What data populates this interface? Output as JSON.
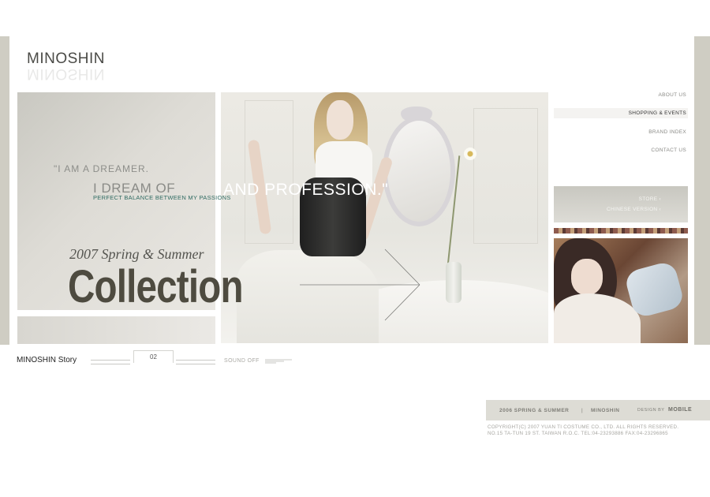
{
  "brand": {
    "logo": "MINOSHIN"
  },
  "hero": {
    "quote_line1": "\"I AM A DREAMER.",
    "quote_line2_gray": "I DREAM OF",
    "quote_line2_white": "AND PROFESSION.\"",
    "quote_line3": "PERFECT BALANCE  BETWEEN MY PASSIONS",
    "season": "2007 Spring & Summer",
    "collection": "Collection"
  },
  "nav": {
    "items": [
      {
        "label": "ABOUT US"
      },
      {
        "label": "SHOPPING & EVENTS"
      },
      {
        "label": "BRAND INDEX"
      },
      {
        "label": "CONTACT US"
      }
    ]
  },
  "store_panel": {
    "links": [
      {
        "label": "STORE  ‹"
      },
      {
        "label": "CHINESE VERSION  ‹"
      }
    ]
  },
  "controls": {
    "story_label": "MINOSHIN Story",
    "page_number": "02",
    "sound_label": "SOUND OFF"
  },
  "footer": {
    "season": "2006  SPRING & SUMMER",
    "separator": "|",
    "brand": "MINOSHIN",
    "design_by": "DESIGN BY",
    "designer": "MOBILE",
    "copyright": "COPYRIGHT(C) 2007  YUAN TI COSTUME CO., LTD.    ALL RIGHTS RESERVED.",
    "address": "NO.15 TA-TUN 19 ST. TAIWAN R.O.C.    TEL:04-23293886    FAX:04-23296865"
  },
  "colors": {
    "frame_gray": "#cfcdc3",
    "collection_text": "#4e4b40",
    "quote_accent": "#2f6b62"
  }
}
